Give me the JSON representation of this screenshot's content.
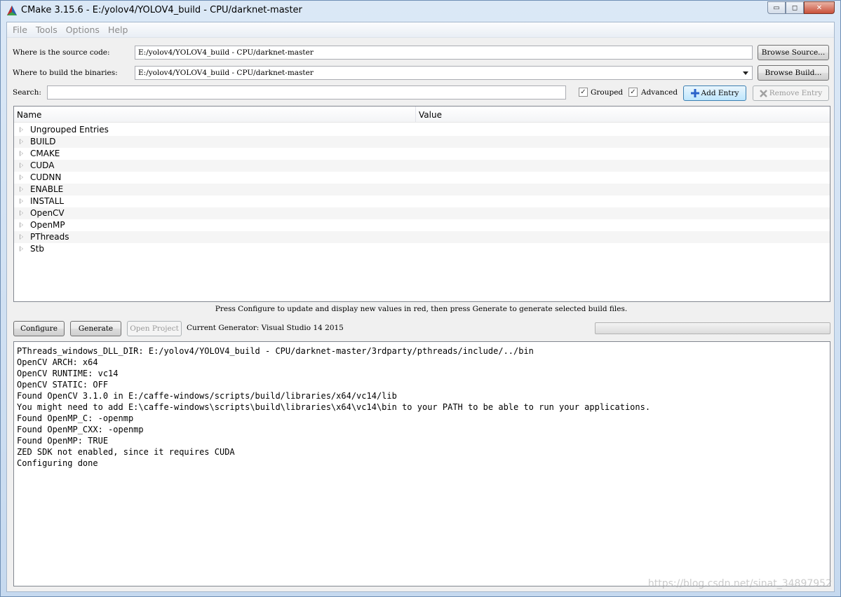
{
  "window": {
    "title": "CMake 3.15.6 - E:/yolov4/YOLOV4_build - CPU/darknet-master",
    "min_glyph": "▭",
    "max_glyph": "◻",
    "close_glyph": "✕"
  },
  "menu": {
    "items": [
      "File",
      "Tools",
      "Options",
      "Help"
    ]
  },
  "source": {
    "label": "Where is the source code:",
    "value": "E:/yolov4/YOLOV4_build - CPU/darknet-master",
    "browse_label": "Browse Source..."
  },
  "build": {
    "label": "Where to build the binaries:",
    "value": "E:/yolov4/YOLOV4_build - CPU/darknet-master",
    "browse_label": "Browse Build..."
  },
  "search": {
    "label": "Search:",
    "value": "",
    "grouped_label": "Grouped",
    "grouped_checked": true,
    "advanced_label": "Advanced",
    "advanced_checked": true,
    "add_entry_label": "Add Entry",
    "remove_entry_label": "Remove Entry"
  },
  "tree": {
    "columns": [
      "Name",
      "Value"
    ],
    "rows": [
      "Ungrouped Entries",
      "BUILD",
      "CMAKE",
      "CUDA",
      "CUDNN",
      "ENABLE",
      "INSTALL",
      "OpenCV",
      "OpenMP",
      "PThreads",
      "Stb"
    ]
  },
  "hint": "Press Configure to update and display new values in red, then press Generate to generate selected build files.",
  "actions": {
    "configure_label": "Configure",
    "generate_label": "Generate",
    "open_project_label": "Open Project",
    "current_generator": "Current Generator: Visual Studio 14 2015",
    "progress": 0
  },
  "output": {
    "lines": [
      "PThreads_windows_DLL_DIR: E:/yolov4/YOLOV4_build - CPU/darknet-master/3rdparty/pthreads/include/../bin",
      "OpenCV ARCH: x64",
      "OpenCV RUNTIME: vc14",
      "OpenCV STATIC: OFF",
      "Found OpenCV 3.1.0 in E:/caffe-windows/scripts/build/libraries/x64/vc14/lib",
      "You might need to add E:\\caffe-windows\\scripts\\build\\libraries\\x64\\vc14\\bin to your PATH to be able to run your applications.",
      "Found OpenMP_C: -openmp",
      "Found OpenMP_CXX: -openmp",
      "Found OpenMP: TRUE",
      "ZED SDK not enabled, since it requires CUDA",
      "Configuring done"
    ]
  },
  "watermark": "https://blog.csdn.net/sinat_34897952",
  "colors": {
    "accent": "#3a6ea5",
    "add_icon": "#2a62c9"
  }
}
